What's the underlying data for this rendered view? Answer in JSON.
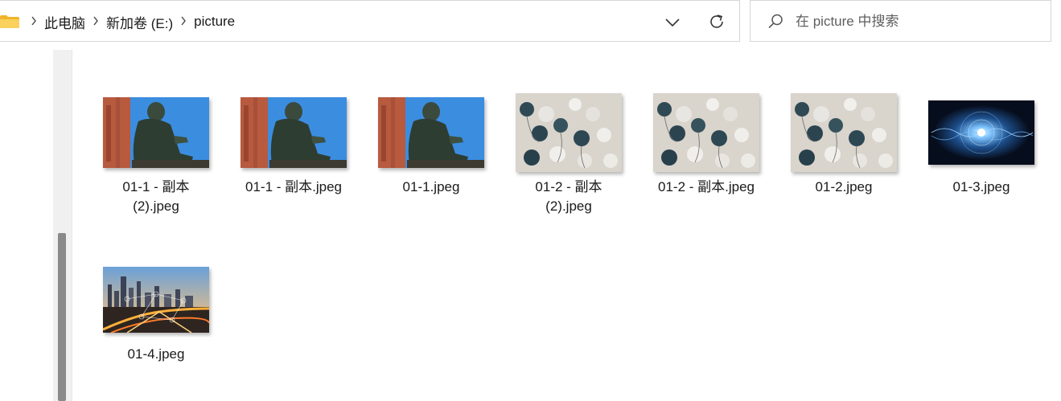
{
  "address_bar": {
    "breadcrumbs": [
      "此电脑",
      "新加卷 (E:)",
      "picture"
    ]
  },
  "search": {
    "placeholder": "在 picture 中搜索"
  },
  "icons": {
    "folder": "folder-icon",
    "chevron": "chevron-right-icon",
    "dropdown": "chevron-down-icon",
    "refresh": "refresh-icon",
    "search": "search-icon"
  },
  "colors": {
    "folder_yellow": "#f4c542",
    "scroll_thumb": "#8a8a8a",
    "border": "#d6d6d6"
  },
  "files": [
    {
      "line1": "01-1 - 副本",
      "line2": "(2).jpeg",
      "image": "statue"
    },
    {
      "line1": "01-1 - 副本.jpeg",
      "line2": "",
      "image": "statue"
    },
    {
      "line1": "01-1.jpeg",
      "line2": "",
      "image": "statue"
    },
    {
      "line1": "01-2 - 副本",
      "line2": "(2).jpeg",
      "image": "spheres"
    },
    {
      "line1": "01-2 - 副本.jpeg",
      "line2": "",
      "image": "spheres"
    },
    {
      "line1": "01-2.jpeg",
      "line2": "",
      "image": "spheres"
    },
    {
      "line1": "01-3.jpeg",
      "line2": "",
      "image": "particles"
    },
    {
      "line1": "01-4.jpeg",
      "line2": "",
      "image": "city"
    }
  ]
}
